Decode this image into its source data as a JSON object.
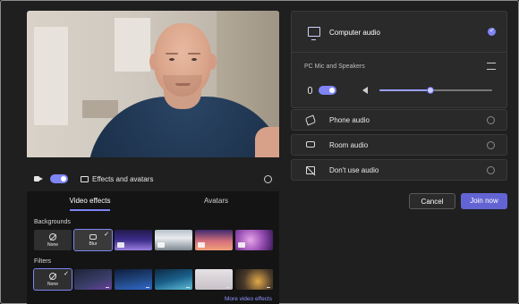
{
  "video": {
    "camera_on": true
  },
  "controls": {
    "effects_label": "Effects and avatars"
  },
  "effects_panel": {
    "tabs": [
      {
        "label": "Video effects",
        "active": true
      },
      {
        "label": "Avatars",
        "active": false
      }
    ],
    "backgrounds_label": "Backgrounds",
    "backgrounds": [
      {
        "label": "None",
        "type": "none"
      },
      {
        "label": "Blur",
        "type": "blur",
        "selected": true
      },
      {
        "type": "image",
        "video": true
      },
      {
        "type": "image",
        "video": true
      },
      {
        "type": "image",
        "video": true
      },
      {
        "type": "image",
        "video": true
      }
    ],
    "filters_label": "Filters",
    "filters": [
      {
        "label": "None",
        "type": "none",
        "selected": true
      },
      {
        "type": "filter",
        "download": true
      },
      {
        "type": "filter",
        "download": true
      },
      {
        "type": "filter",
        "download": true
      },
      {
        "type": "filter",
        "download": true
      },
      {
        "type": "filter",
        "download": true
      }
    ],
    "more_link": "More video effects"
  },
  "audio": {
    "computer_audio": {
      "title": "Computer audio",
      "selected": true,
      "device": "PC Mic and Speakers",
      "mic_on": true,
      "volume": 0.45
    },
    "options": [
      {
        "label": "Phone audio",
        "icon": "phone-icon",
        "selected": false
      },
      {
        "label": "Room audio",
        "icon": "room-icon",
        "selected": false
      },
      {
        "label": "Don't use audio",
        "icon": "no-audio-icon",
        "selected": false
      }
    ]
  },
  "actions": {
    "cancel": "Cancel",
    "join": "Join now"
  },
  "colors": {
    "accent": "#7f85f5",
    "join_button": "#6264d3",
    "background": "#1f1f1f"
  }
}
